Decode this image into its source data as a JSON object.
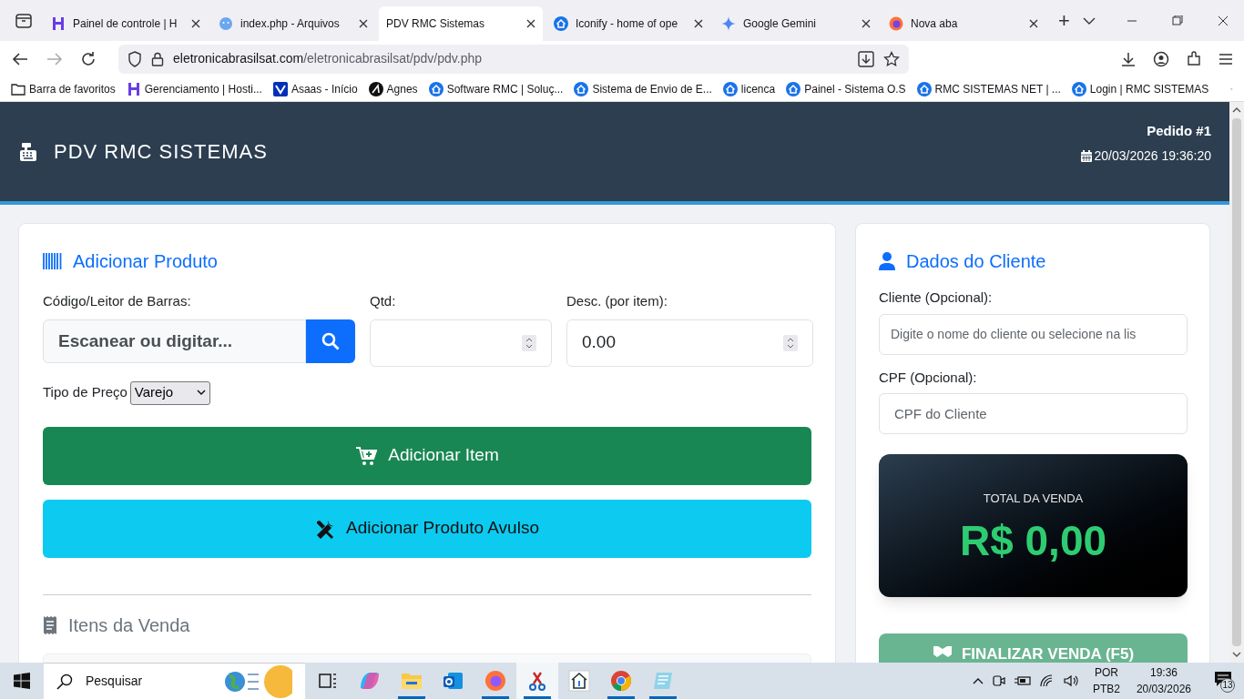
{
  "browser": {
    "tabs": [
      {
        "title": "Painel de controle | H",
        "kind": "h",
        "selected": false
      },
      {
        "title": "index.php - Arquivos",
        "kind": "face",
        "selected": false
      },
      {
        "title": "PDV RMC Sistemas",
        "kind": "plain",
        "selected": true
      },
      {
        "title": "Iconify - home of ope",
        "kind": "house",
        "selected": false
      },
      {
        "title": "Google Gemini",
        "kind": "star",
        "selected": false
      },
      {
        "title": "Nova aba",
        "kind": "fox",
        "selected": false
      }
    ],
    "new_tab": "+",
    "url_host": "eletronicabrasilsat.com",
    "url_path": "/eletronicabrasilsat/pdv/pdv.php",
    "bookmarks": [
      {
        "label": "Barra de favoritos",
        "kind": "folder"
      },
      {
        "label": "Gerenciamento | Hosti...",
        "kind": "h"
      },
      {
        "label": "Asaas - Início",
        "kind": "asaas"
      },
      {
        "label": "Agnes",
        "kind": "agnes"
      },
      {
        "label": "Software RMC | Soluç...",
        "kind": "house"
      },
      {
        "label": "Sistema de Envio de E...",
        "kind": "house"
      },
      {
        "label": "licenca",
        "kind": "house"
      },
      {
        "label": "Painel - Sistema O.S",
        "kind": "house"
      },
      {
        "label": "RMC SISTEMAS NET | ...",
        "kind": "house"
      },
      {
        "label": "Login | RMC SISTEMAS",
        "kind": "house"
      }
    ]
  },
  "header": {
    "title": "PDV RMC SISTEMAS",
    "order": "Pedido #1",
    "datetime": "20/03/2026 19:36:20"
  },
  "product": {
    "heading": "Adicionar Produto",
    "code_label": "Código/Leitor de Barras:",
    "code_placeholder": "Escanear ou digitar...",
    "qty_label": "Qtd:",
    "discount_label": "Desc. (por item):",
    "discount_value": "0.00",
    "price_type_label": "Tipo de Preço",
    "price_type": "Varejo",
    "add_button": "Adicionar Item",
    "loose_button": "Adicionar Produto Avulso",
    "items_heading": "Itens da Venda"
  },
  "client": {
    "heading": "Dados do Cliente",
    "client_label": "Cliente (Opcional):",
    "client_placeholder": "Digite o nome do cliente ou selecione na lis",
    "cpf_label": "CPF (Opcional):",
    "cpf_placeholder": "CPF do Cliente",
    "total_label": "TOTAL DA VENDA",
    "total_value": "R$ 0,00",
    "finish_button": "FINALIZAR VENDA (F5)",
    "finish_disabled": true
  },
  "taskbar": {
    "search": "Pesquisar",
    "apps": [
      {
        "kind": "taskview",
        "running": false,
        "selected": false
      },
      {
        "kind": "copilot",
        "running": false,
        "selected": false
      },
      {
        "kind": "files",
        "running": true,
        "selected": false
      },
      {
        "kind": "outlook",
        "running": false,
        "selected": false
      },
      {
        "kind": "firefox",
        "running": true,
        "selected": false
      },
      {
        "kind": "snip",
        "running": true,
        "selected": true
      },
      {
        "kind": "home",
        "running": false,
        "selected": false
      },
      {
        "kind": "chrome",
        "running": true,
        "selected": false
      },
      {
        "kind": "notepad",
        "running": true,
        "selected": false
      }
    ],
    "lang": "POR",
    "layout": "PTB2",
    "time": "19:36",
    "date": "20/03/2026",
    "notifications": "13"
  }
}
